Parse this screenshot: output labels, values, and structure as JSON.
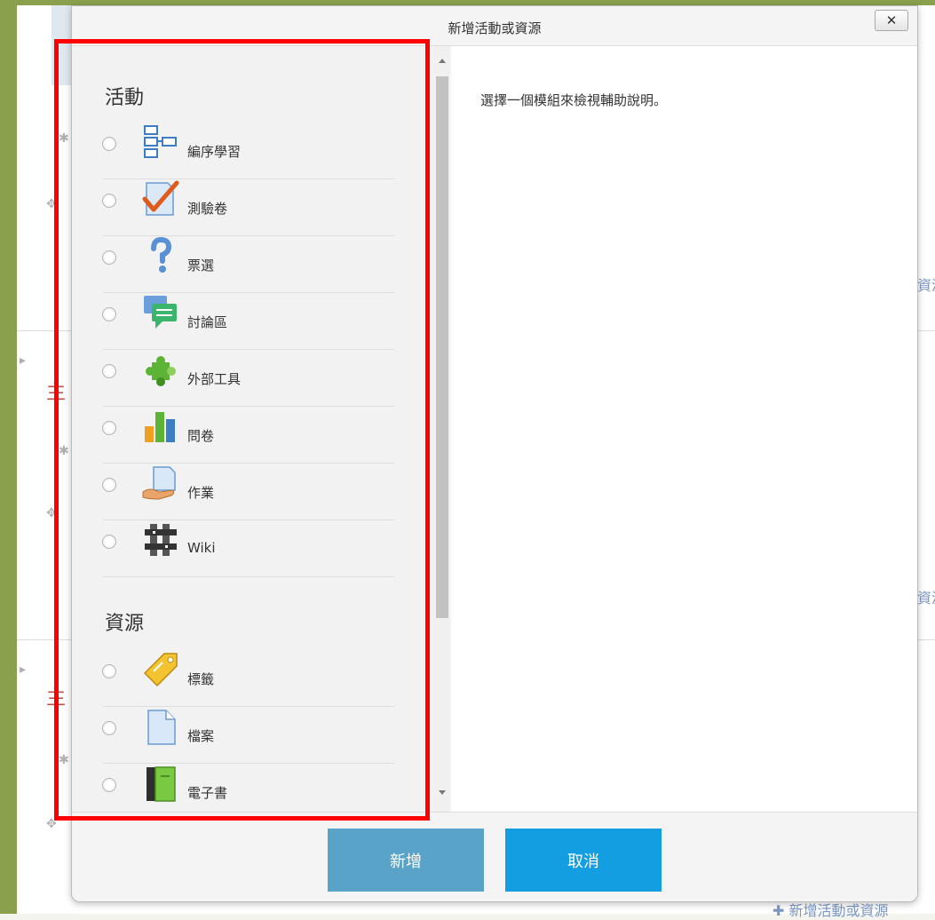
{
  "dialog": {
    "title": "新增活動或資源",
    "close_label": "✕",
    "help_text": "選擇一個模組來檢視輔助說明。"
  },
  "activities": {
    "heading": "活動",
    "items": [
      {
        "label": "編序學習",
        "icon": "lesson-icon"
      },
      {
        "label": "測驗卷",
        "icon": "quiz-icon"
      },
      {
        "label": "票選",
        "icon": "choice-icon"
      },
      {
        "label": "討論區",
        "icon": "forum-icon"
      },
      {
        "label": "外部工具",
        "icon": "external-tool-icon"
      },
      {
        "label": "問卷",
        "icon": "survey-icon"
      },
      {
        "label": "作業",
        "icon": "assignment-icon"
      },
      {
        "label": "Wiki",
        "icon": "wiki-icon"
      }
    ]
  },
  "resources": {
    "heading": "資源",
    "items": [
      {
        "label": "標籤",
        "icon": "label-icon"
      },
      {
        "label": "檔案",
        "icon": "file-icon"
      },
      {
        "label": "電子書",
        "icon": "book-icon"
      }
    ]
  },
  "footer": {
    "add_label": "新增",
    "cancel_label": "取消"
  },
  "background": {
    "bottom_link": "新增活動或資源",
    "partial_link": "資源",
    "heading_fragment": "主"
  },
  "colors": {
    "frame_green": "#8aa04c",
    "highlight_red": "#ff0000",
    "add_button": "#5aa3c8",
    "cancel_button": "#129ee0"
  }
}
